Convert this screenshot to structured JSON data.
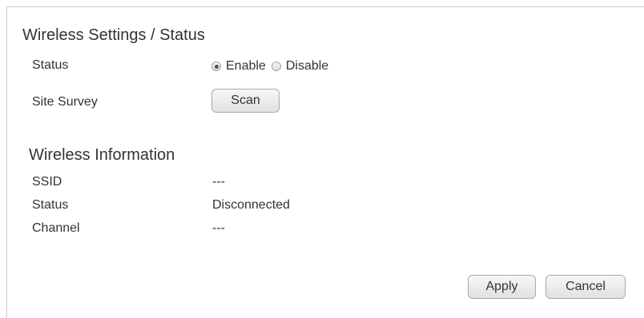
{
  "settings_section": {
    "title": "Wireless Settings / Status",
    "status_label": "Status",
    "status_options": {
      "enable_label": "Enable",
      "disable_label": "Disable",
      "selected": "Enable"
    },
    "site_survey_label": "Site Survey",
    "scan_button": "Scan"
  },
  "info_section": {
    "title": "Wireless Information",
    "rows": [
      {
        "label": "SSID",
        "value": "---"
      },
      {
        "label": "Status",
        "value": "Disconnected"
      },
      {
        "label": "Channel",
        "value": "---"
      }
    ]
  },
  "actions": {
    "apply_label": "Apply",
    "cancel_label": "Cancel"
  }
}
